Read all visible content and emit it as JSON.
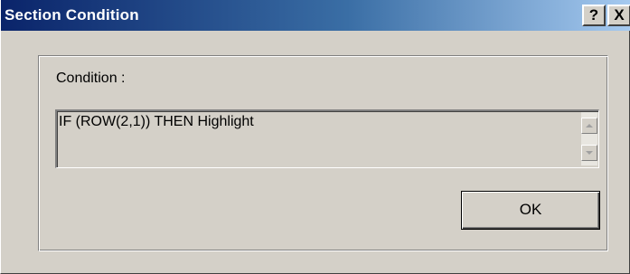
{
  "window": {
    "title": "Section Condition",
    "help_label": "?",
    "close_label": "X"
  },
  "condition": {
    "label": "Condition :",
    "value": "IF (ROW(2,1)) THEN Highlight"
  },
  "buttons": {
    "ok_label": "OK"
  },
  "icons": {
    "scroll_up": "scroll-up-arrow-icon",
    "scroll_down": "scroll-down-arrow-icon"
  },
  "colors": {
    "titlebar_start": "#0a246a",
    "titlebar_end": "#a6caf0",
    "face": "#d4d0c8"
  }
}
